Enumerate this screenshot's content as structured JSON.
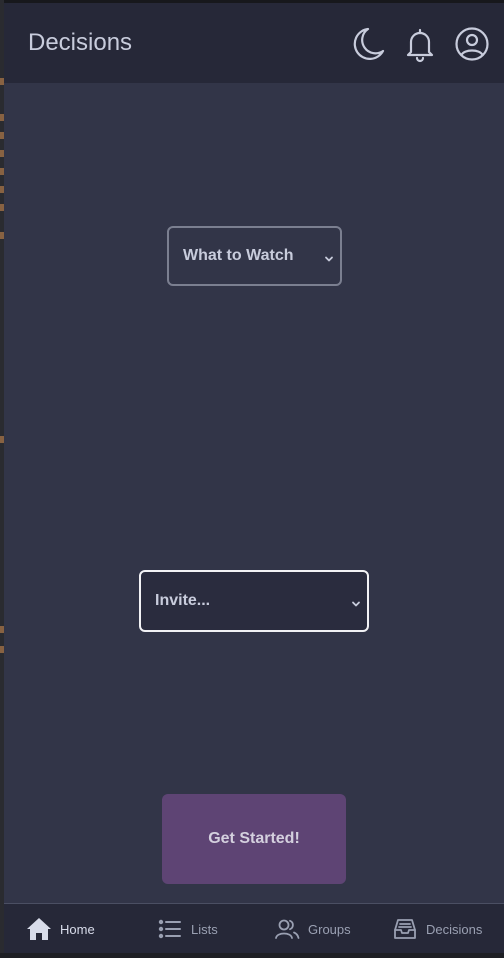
{
  "header": {
    "title": "Decisions",
    "icons": [
      "moon-icon",
      "bell-icon",
      "user-circle-icon"
    ]
  },
  "main": {
    "category_select": {
      "value": "What to Watch"
    },
    "invite_select": {
      "value": "Invite..."
    },
    "cta_label": "Get Started!"
  },
  "tabs": [
    {
      "label": "Home",
      "icon": "home-icon",
      "active": true
    },
    {
      "label": "Lists",
      "icon": "list-icon",
      "active": false
    },
    {
      "label": "Groups",
      "icon": "users-icon",
      "active": false
    },
    {
      "label": "Decisions",
      "icon": "inbox-icon",
      "active": false
    }
  ],
  "colors": {
    "background": "#323548",
    "header": "#262838",
    "accent": "#5e4474",
    "text": "#c8ccdc"
  }
}
